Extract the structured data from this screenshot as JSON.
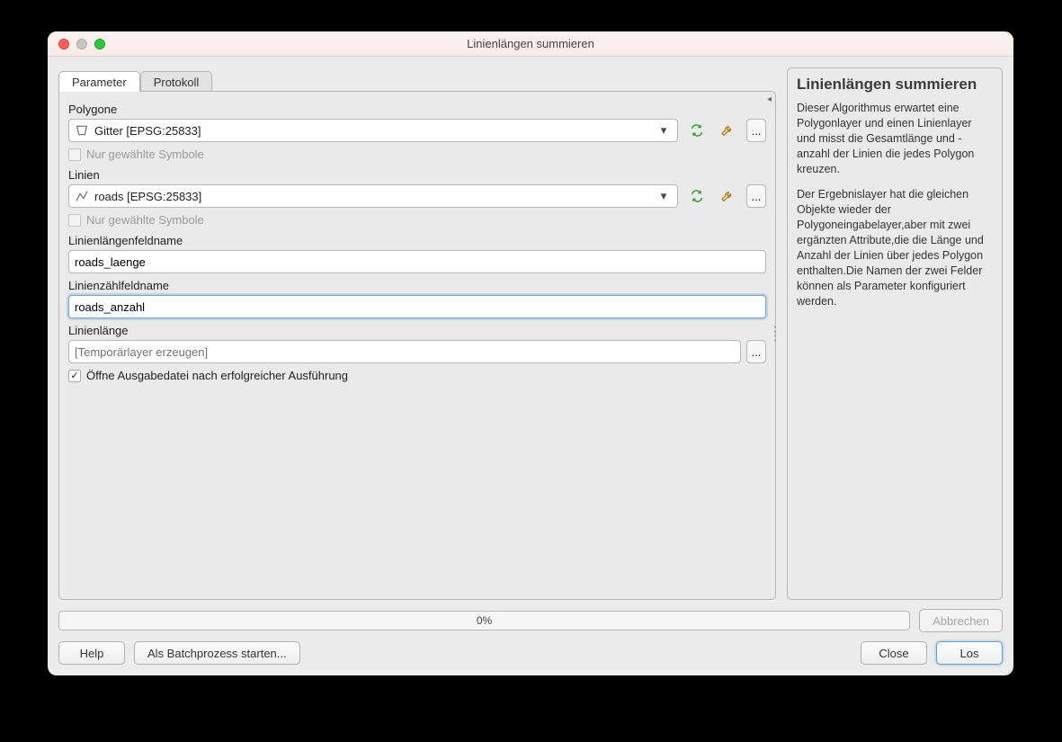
{
  "window": {
    "title": "Linienlängen summieren"
  },
  "tabs": {
    "parameter": "Parameter",
    "protokoll": "Protokoll"
  },
  "params": {
    "polygone_label": "Polygone",
    "polygone_value": "Gitter [EPSG:25833]",
    "nur_gewaehlte": "Nur gewählte Symbole",
    "linien_label": "Linien",
    "linien_value": "roads [EPSG:25833]",
    "len_field_label": "Linienlängenfeldname",
    "len_field_value": "roads_laenge",
    "count_field_label": "Linienzählfeldname",
    "count_field_value": "roads_anzahl",
    "output_label": "Linienlänge",
    "output_placeholder": "[Temporärlayer erzeugen]",
    "open_after": "Öffne Ausgabedatei nach erfolgreicher Ausführung"
  },
  "help": {
    "title": "Linienlängen summieren",
    "p1": "Dieser Algorithmus erwartet eine Polygonlayer und einen Linienlayer und misst die Gesamtlänge und -anzahl der Linien die jedes Polygon kreuzen.",
    "p2": "Der Ergebnislayer hat die gleichen Objekte wieder der Polygoneingabelayer,aber mit zwei ergänzten Attribute,die die Länge und Anzahl der Linien über jedes Polygon enthalten.Die Namen der zwei Felder können als Parameter konfiguriert werden."
  },
  "progress": {
    "text": "0%"
  },
  "buttons": {
    "abbrechen": "Abbrechen",
    "help": "Help",
    "batch": "Als Batchprozess starten...",
    "close": "Close",
    "los": "Los"
  }
}
